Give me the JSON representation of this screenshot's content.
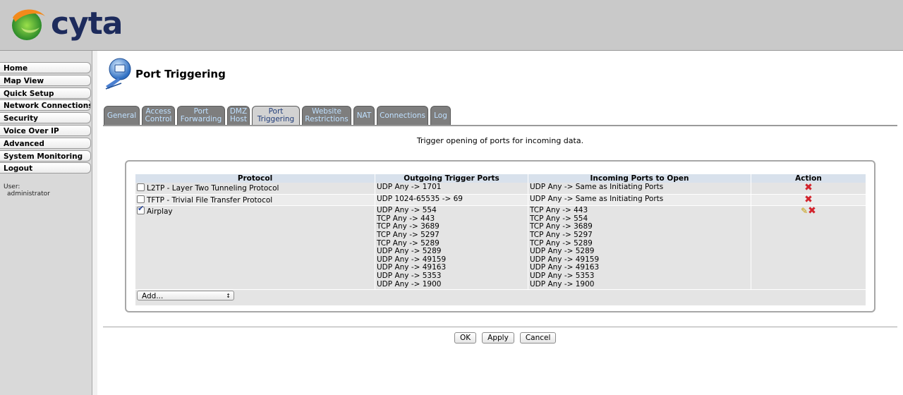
{
  "brand": {
    "name": "cyta"
  },
  "sidebar": {
    "items": [
      {
        "label": "Home"
      },
      {
        "label": "Map View"
      },
      {
        "label": "Quick Setup"
      },
      {
        "label": "Network Connections"
      },
      {
        "label": "Security"
      },
      {
        "label": "Voice Over IP"
      },
      {
        "label": "Advanced"
      },
      {
        "label": "System Monitoring"
      },
      {
        "label": "Logout"
      }
    ],
    "user_label": "User:",
    "user_name": "administrator"
  },
  "page": {
    "title": "Port Triggering",
    "intro": "Trigger opening of ports for incoming data."
  },
  "tabs": [
    {
      "l1": "General",
      "l2": ""
    },
    {
      "l1": "Access",
      "l2": "Control"
    },
    {
      "l1": "Port",
      "l2": "Forwarding"
    },
    {
      "l1": "DMZ",
      "l2": "Host"
    },
    {
      "l1": "Port",
      "l2": "Triggering",
      "active": true
    },
    {
      "l1": "Website",
      "l2": "Restrictions"
    },
    {
      "l1": "NAT",
      "l2": ""
    },
    {
      "l1": "Connections",
      "l2": ""
    },
    {
      "l1": "Log",
      "l2": ""
    }
  ],
  "table": {
    "headers": {
      "protocol": "Protocol",
      "outgoing": "Outgoing Trigger Ports",
      "incoming": "Incoming Ports to Open",
      "action": "Action"
    },
    "rows": [
      {
        "protocol": "L2TP - Layer Two Tunneling Protocol",
        "checked": false,
        "outgoing": [
          "UDP Any -> 1701"
        ],
        "incoming": [
          "UDP Any -> Same as Initiating Ports"
        ],
        "edit": false
      },
      {
        "protocol": "TFTP - Trivial File Transfer Protocol",
        "checked": false,
        "outgoing": [
          "UDP 1024-65535 -> 69"
        ],
        "incoming": [
          "UDP Any -> Same as Initiating Ports"
        ],
        "edit": false
      },
      {
        "protocol": "Airplay",
        "checked": true,
        "outgoing": [
          "UDP Any -> 554",
          "TCP Any -> 443",
          "TCP Any -> 3689",
          "TCP Any -> 5297",
          "TCP Any -> 5289",
          "UDP Any -> 5289",
          "UDP Any -> 49159",
          "UDP Any -> 49163",
          "UDP Any -> 5353",
          "UDP Any -> 1900"
        ],
        "incoming": [
          "TCP Any -> 443",
          "TCP Any -> 554",
          "TCP Any -> 3689",
          "TCP Any -> 5297",
          "TCP Any -> 5289",
          "UDP Any -> 5289",
          "UDP Any -> 49159",
          "UDP Any -> 49163",
          "UDP Any -> 5353",
          "UDP Any -> 1900"
        ],
        "edit": true
      }
    ],
    "add_select": "Add..."
  },
  "buttons": {
    "ok": "OK",
    "apply": "Apply",
    "cancel": "Cancel"
  },
  "icons": {
    "delete": "delete-x-icon",
    "edit": "pencil-edit-icon",
    "page": "port-triggering-globe-icon"
  },
  "colors": {
    "header_bg": "#c9c9c9",
    "tab_active_text": "#223e7a",
    "tab_text": "#bfe0ff",
    "delete_red": "#d2222b"
  }
}
